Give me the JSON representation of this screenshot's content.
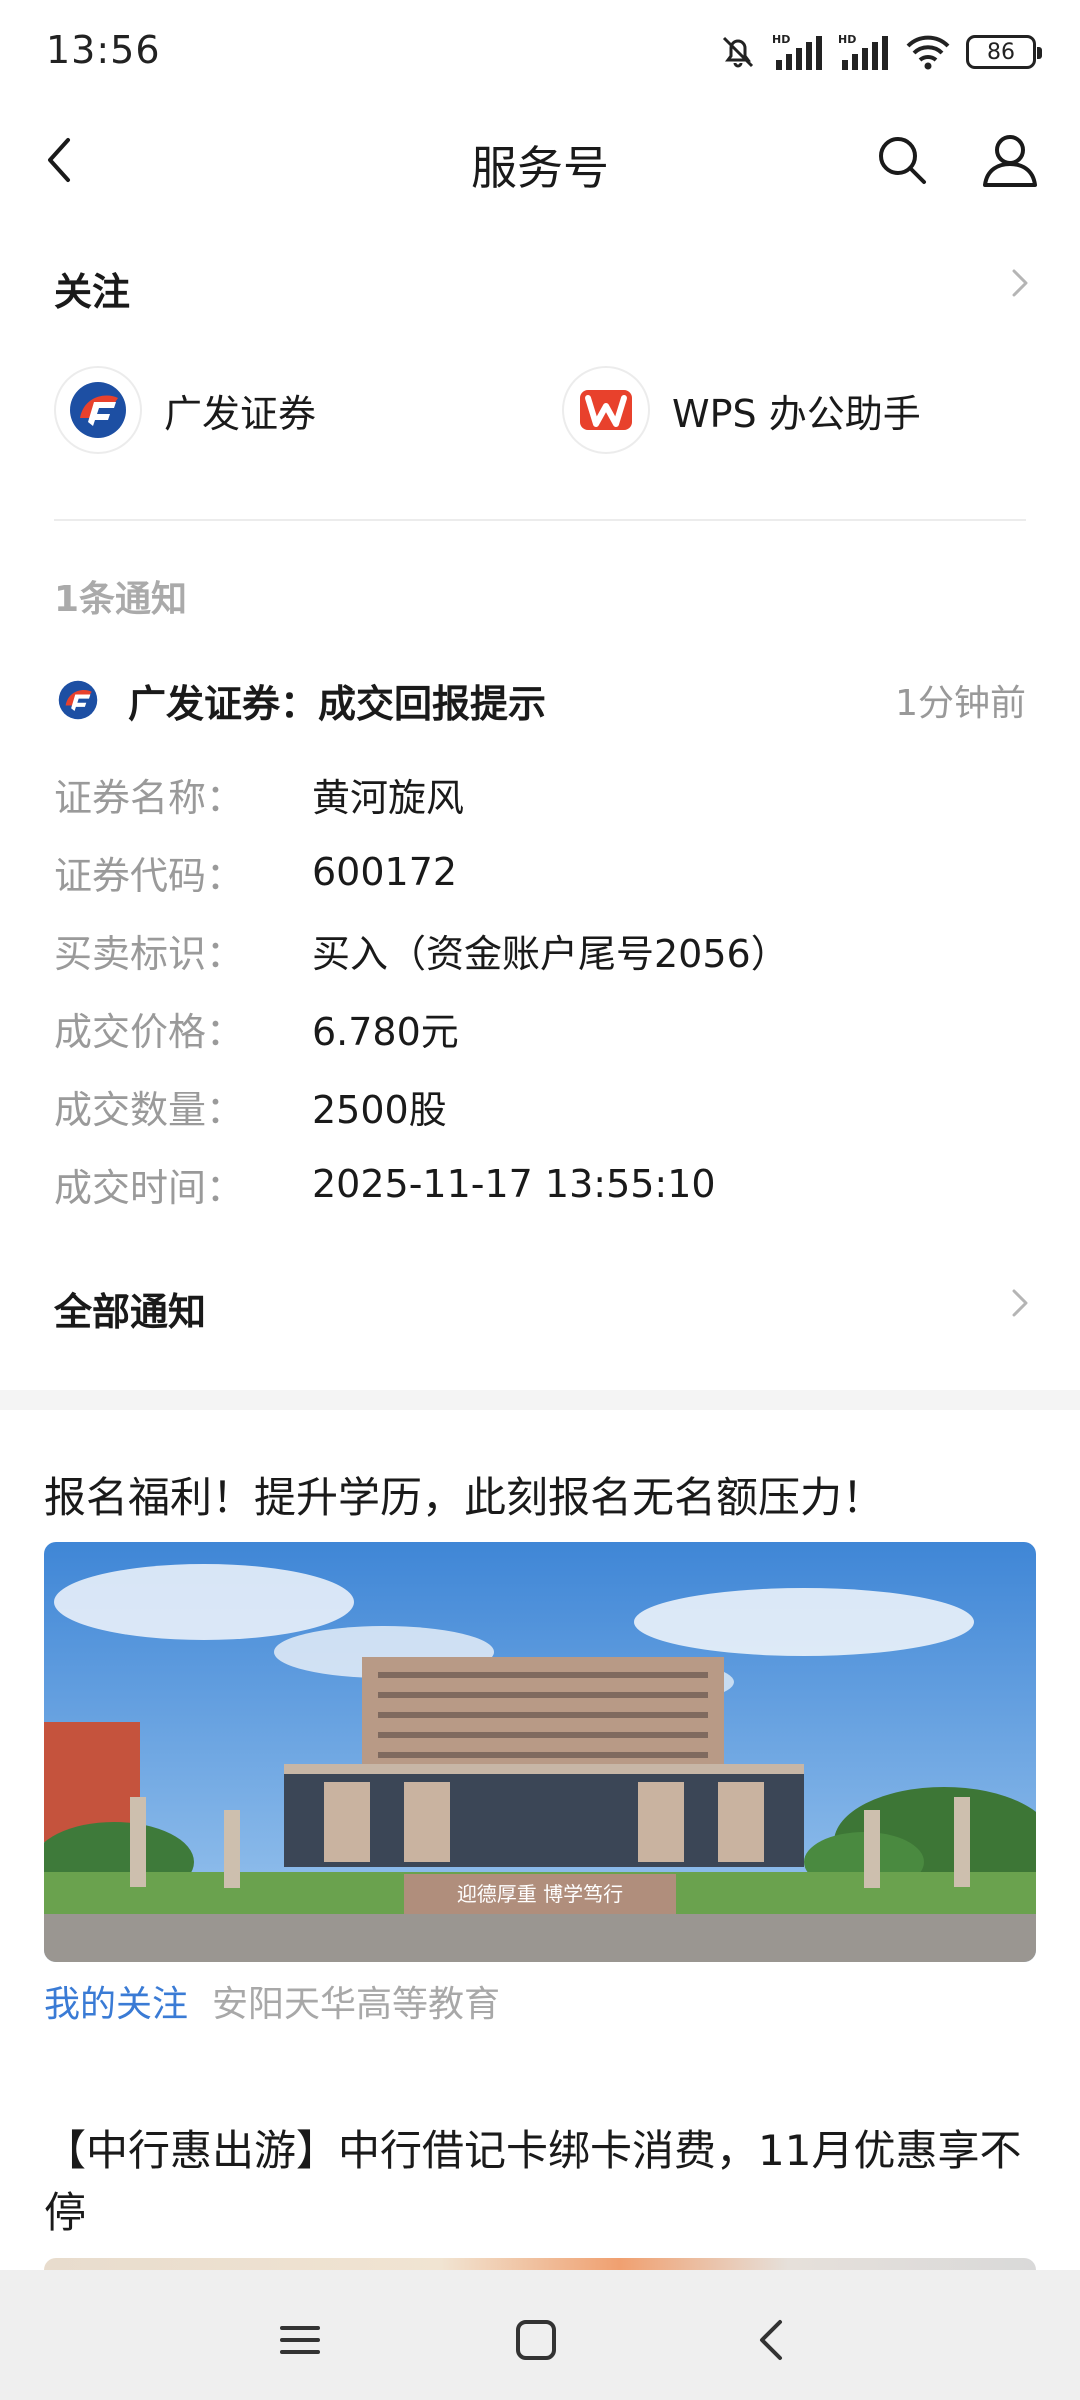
{
  "status_bar": {
    "time": "13:56",
    "battery": "86",
    "network_badge_1": "HD",
    "network_badge_2": "HD"
  },
  "header": {
    "title": "服务号"
  },
  "following": {
    "title": "关注",
    "items": [
      {
        "name": "广发证券",
        "icon": "gf-securities-logo"
      },
      {
        "name": "WPS 办公助手",
        "icon": "wps-logo"
      }
    ]
  },
  "notification": {
    "count_label": "1条通知",
    "title": "广发证券：成交回报提示",
    "time": "1分钟前",
    "rows": [
      {
        "label": "证券名称：",
        "value": "黄河旋风"
      },
      {
        "label": "证券代码：",
        "value": "600172"
      },
      {
        "label": "买卖标识：",
        "value": "买入（资金账户尾号2056）"
      },
      {
        "label": "成交价格：",
        "value": "6.780元"
      },
      {
        "label": "成交数量：",
        "value": "2500股"
      },
      {
        "label": "成交时间：",
        "value": "2025-11-17 13:55:10"
      }
    ],
    "all_label": "全部通知"
  },
  "feed": [
    {
      "title": "报名福利！提升学历，此刻报名无名额压力！",
      "image_caption": "迎德厚重 博学笃行",
      "tag": "我的关注",
      "source": "安阳天华高等教育"
    },
    {
      "title": "【中行惠出游】中行借记卡绑卡消费，11月优惠享不停"
    }
  ],
  "colors": {
    "accent_blue": "#3a7bd5",
    "label_gray": "#9a9a9a",
    "wps_red": "#e8412c",
    "gf_blue": "#1d4fa3"
  }
}
